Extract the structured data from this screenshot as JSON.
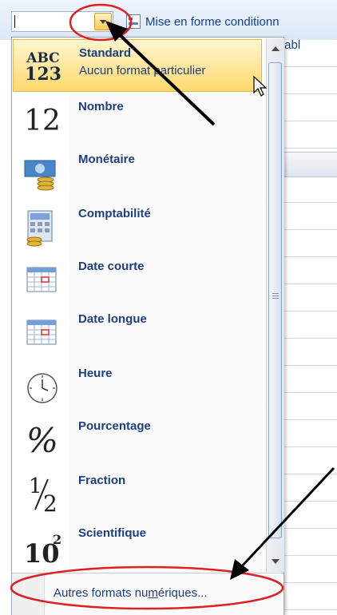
{
  "ribbon": {
    "conditional_format_label": "Mise en forme conditionn",
    "table_fragment": "tabl"
  },
  "menu": {
    "items": [
      {
        "label": "Standard",
        "sublabel": "Aucun format particulier",
        "icon": "abc-123-icon",
        "selected": true
      },
      {
        "label": "Nombre",
        "icon": "number-12-icon"
      },
      {
        "label": "Monétaire",
        "icon": "currency-bill-coins-icon"
      },
      {
        "label": "Comptabilité",
        "icon": "accounting-calculator-icon"
      },
      {
        "label": "Date courte",
        "icon": "calendar-short-icon"
      },
      {
        "label": "Date longue",
        "icon": "calendar-long-icon"
      },
      {
        "label": "Heure",
        "icon": "clock-icon"
      },
      {
        "label": "Pourcentage",
        "icon": "percent-icon"
      },
      {
        "label": "Fraction",
        "icon": "fraction-icon"
      },
      {
        "label": "Scientifique",
        "icon": "power-of-ten-icon"
      }
    ],
    "footer_prefix": "Autres formats nu",
    "footer_accel": "m",
    "footer_suffix": "ériques..."
  },
  "icons": {
    "abc_top": "ABC",
    "abc_bottom": "123",
    "number": "12",
    "percent": "%",
    "fraction_num": "1",
    "fraction_den": "2",
    "sci_base": "10",
    "sci_exp": "2"
  },
  "colors": {
    "highlight": "#ffd86e",
    "label_text": "#1c3f80",
    "annotation_red": "#e02020"
  }
}
